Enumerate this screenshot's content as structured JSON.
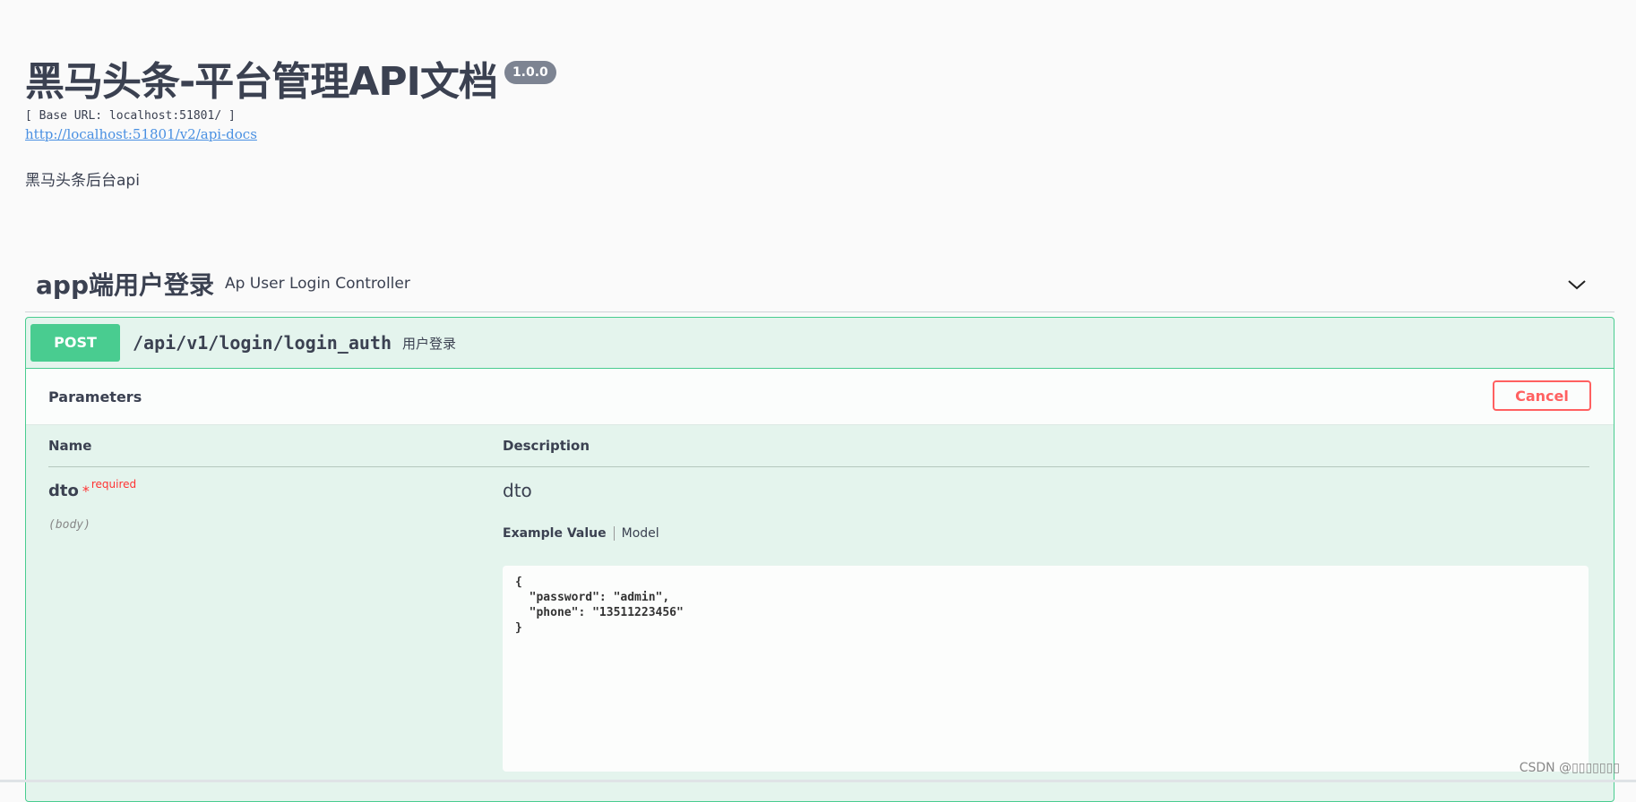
{
  "info": {
    "title": "黑马头条-平台管理API文档",
    "version": "1.0.0",
    "base_url": "[ Base URL: localhost:51801/ ]",
    "docs_link": "http://localhost:51801/v2/api-docs",
    "description": "黑马头条后台api"
  },
  "tag": {
    "name": "app端用户登录",
    "description": "Ap User Login Controller",
    "toggle_icon": "chevron-down-icon"
  },
  "operation": {
    "method": "POST",
    "path": "/api/v1/login/login_auth",
    "summary": "用户登录",
    "parameters_title": "Parameters",
    "cancel_label": "Cancel",
    "table": {
      "col_name": "Name",
      "col_description": "Description"
    },
    "param": {
      "name": "dto",
      "required_star": "*",
      "required_label": "required",
      "location": "(body)",
      "description": "dto",
      "tab_example": "Example Value",
      "tab_model": "Model",
      "example": "{\n  \"password\": \"admin\",\n  \"phone\": \"13511223456\"\n}"
    }
  },
  "watermark": "CSDN @▯▯▯▯▯▯▯",
  "colors": {
    "post_green": "#49cc90",
    "cancel_red": "#ff6060",
    "link_blue": "#4990e2",
    "text": "#3b4151"
  }
}
